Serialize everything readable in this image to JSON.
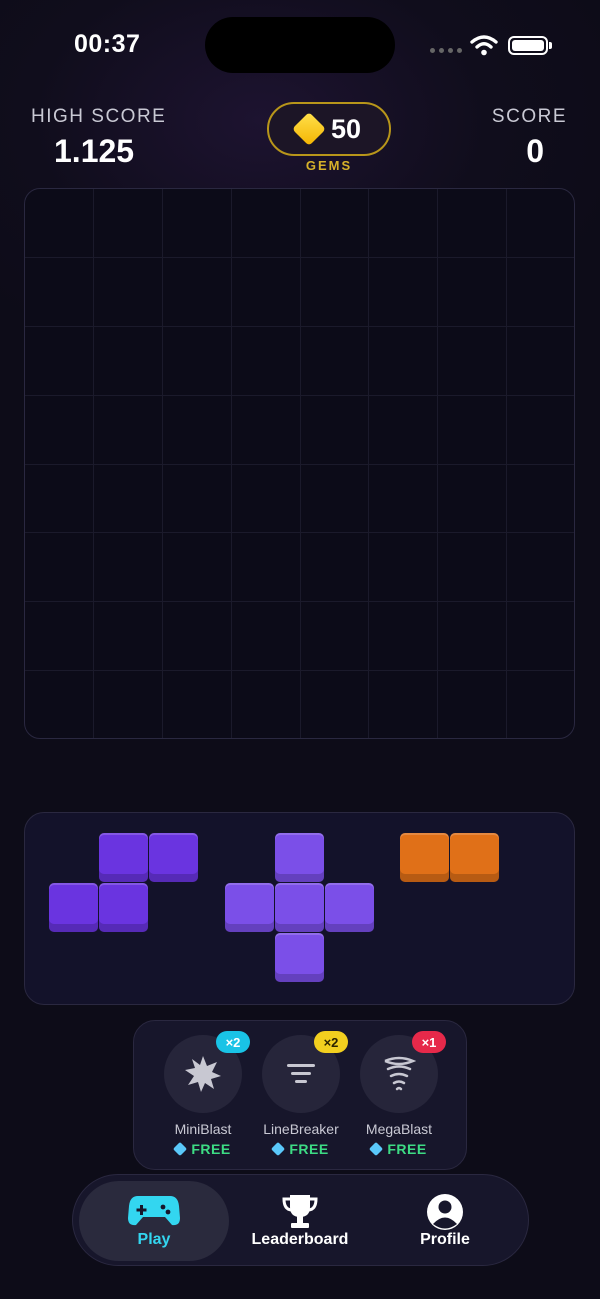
{
  "status_bar": {
    "time": "00:37"
  },
  "header": {
    "high_score_label": "HIGH SCORE",
    "high_score_value": "1.125",
    "score_label": "SCORE",
    "score_value": "0",
    "gems_count": "50",
    "gems_label": "GEMS"
  },
  "board": {
    "rows": 8,
    "cols": 8
  },
  "tray": {
    "pieces": [
      {
        "shape": "s-tetromino",
        "color": "#6a34e0"
      },
      {
        "shape": "plus-pentomino",
        "color": "#7b4fe8"
      },
      {
        "shape": "domino-horizontal",
        "color": "#e07018"
      }
    ]
  },
  "powerups": [
    {
      "name": "MiniBlast",
      "badge": "×2",
      "badge_color": "#19c3e6",
      "price": "FREE",
      "icon": "burst-icon"
    },
    {
      "name": "LineBreaker",
      "badge": "×2",
      "badge_color": "#f2cf1f",
      "price": "FREE",
      "icon": "lines-icon"
    },
    {
      "name": "MegaBlast",
      "badge": "×1",
      "badge_color": "#e6294a",
      "price": "FREE",
      "icon": "tornado-icon"
    }
  ],
  "tabs": [
    {
      "label": "Play",
      "icon": "gamepad-icon",
      "active": true
    },
    {
      "label": "Leaderboard",
      "icon": "trophy-icon",
      "active": false
    },
    {
      "label": "Profile",
      "icon": "profile-icon",
      "active": false
    }
  ],
  "colors": {
    "accent": "#33d6f0",
    "gold": "#d7b22a",
    "free_green": "#3ddc84"
  }
}
